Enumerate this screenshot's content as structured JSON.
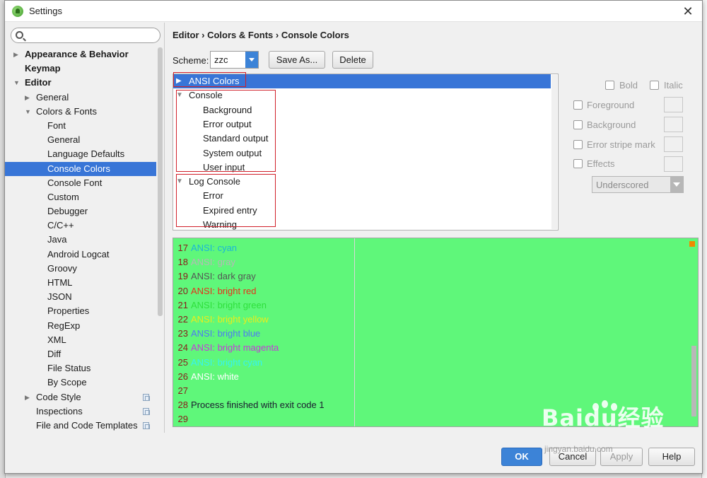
{
  "window": {
    "title": "Settings"
  },
  "sidebar": {
    "search_placeholder": "",
    "items": [
      {
        "label": "Appearance & Behavior",
        "indent": 0,
        "bold": true,
        "arrow": "▶"
      },
      {
        "label": "Keymap",
        "indent": 0,
        "bold": true,
        "arrow": ""
      },
      {
        "label": "Editor",
        "indent": 0,
        "bold": true,
        "arrow": "▼"
      },
      {
        "label": "General",
        "indent": 1,
        "bold": false,
        "arrow": "▶"
      },
      {
        "label": "Colors & Fonts",
        "indent": 1,
        "bold": false,
        "arrow": "▼"
      },
      {
        "label": "Font",
        "indent": 2,
        "bold": false,
        "arrow": ""
      },
      {
        "label": "General",
        "indent": 2,
        "bold": false,
        "arrow": ""
      },
      {
        "label": "Language Defaults",
        "indent": 2,
        "bold": false,
        "arrow": ""
      },
      {
        "label": "Console Colors",
        "indent": 2,
        "bold": false,
        "arrow": "",
        "selected": true
      },
      {
        "label": "Console Font",
        "indent": 2,
        "bold": false,
        "arrow": ""
      },
      {
        "label": "Custom",
        "indent": 2,
        "bold": false,
        "arrow": ""
      },
      {
        "label": "Debugger",
        "indent": 2,
        "bold": false,
        "arrow": ""
      },
      {
        "label": "C/C++",
        "indent": 2,
        "bold": false,
        "arrow": ""
      },
      {
        "label": "Java",
        "indent": 2,
        "bold": false,
        "arrow": ""
      },
      {
        "label": "Android Logcat",
        "indent": 2,
        "bold": false,
        "arrow": ""
      },
      {
        "label": "Groovy",
        "indent": 2,
        "bold": false,
        "arrow": ""
      },
      {
        "label": "HTML",
        "indent": 2,
        "bold": false,
        "arrow": ""
      },
      {
        "label": "JSON",
        "indent": 2,
        "bold": false,
        "arrow": ""
      },
      {
        "label": "Properties",
        "indent": 2,
        "bold": false,
        "arrow": ""
      },
      {
        "label": "RegExp",
        "indent": 2,
        "bold": false,
        "arrow": ""
      },
      {
        "label": "XML",
        "indent": 2,
        "bold": false,
        "arrow": ""
      },
      {
        "label": "Diff",
        "indent": 2,
        "bold": false,
        "arrow": ""
      },
      {
        "label": "File Status",
        "indent": 2,
        "bold": false,
        "arrow": ""
      },
      {
        "label": "By Scope",
        "indent": 2,
        "bold": false,
        "arrow": ""
      },
      {
        "label": "Code Style",
        "indent": 1,
        "bold": false,
        "arrow": "▶",
        "copy": true
      },
      {
        "label": "Inspections",
        "indent": 1,
        "bold": false,
        "arrow": "",
        "copy": true
      },
      {
        "label": "File and Code Templates",
        "indent": 1,
        "bold": false,
        "arrow": "",
        "copy": true
      }
    ]
  },
  "main": {
    "breadcrumb": "Editor › Colors & Fonts › Console Colors",
    "scheme_label": "Scheme:",
    "scheme_value": "zzc",
    "save_as_label": "Save As...",
    "delete_label": "Delete",
    "color_tree": [
      {
        "label": "ANSI Colors",
        "indent": 0,
        "arrow": "▶",
        "selected": true
      },
      {
        "label": "Console",
        "indent": 0,
        "arrow": "▼"
      },
      {
        "label": "Background",
        "indent": 1,
        "arrow": ""
      },
      {
        "label": "Error output",
        "indent": 1,
        "arrow": ""
      },
      {
        "label": "Standard output",
        "indent": 1,
        "arrow": ""
      },
      {
        "label": "System output",
        "indent": 1,
        "arrow": ""
      },
      {
        "label": "User input",
        "indent": 1,
        "arrow": ""
      },
      {
        "label": "Log Console",
        "indent": 0,
        "arrow": "▼"
      },
      {
        "label": "Error",
        "indent": 1,
        "arrow": ""
      },
      {
        "label": "Expired entry",
        "indent": 1,
        "arrow": ""
      },
      {
        "label": "Warning",
        "indent": 1,
        "arrow": ""
      }
    ]
  },
  "properties": {
    "bold_label": "Bold",
    "italic_label": "Italic",
    "foreground_label": "Foreground",
    "background_label": "Background",
    "error_stripe_label": "Error stripe mark",
    "effects_label": "Effects",
    "effect_type": "Underscored"
  },
  "preview": {
    "background": "#5ff77a",
    "lines": [
      {
        "num": "17",
        "text": "ANSI: cyan",
        "color": "#1bb5d8"
      },
      {
        "num": "18",
        "text": "ANSI: gray",
        "color": "#b7b7b7"
      },
      {
        "num": "19",
        "text": "ANSI: dark gray",
        "color": "#555555"
      },
      {
        "num": "20",
        "text": "ANSI: bright red",
        "color": "#e8301a"
      },
      {
        "num": "21",
        "text": "ANSI: bright green",
        "color": "#2fe03c"
      },
      {
        "num": "22",
        "text": "ANSI: bright yellow",
        "color": "#ecec1a"
      },
      {
        "num": "23",
        "text": "ANSI: bright blue",
        "color": "#4f7af2"
      },
      {
        "num": "24",
        "text": "ANSI: bright magenta",
        "color": "#c43bd8"
      },
      {
        "num": "25",
        "text": "ANSI: bright cyan",
        "color": "#35f3f3"
      },
      {
        "num": "26",
        "text": "ANSI: white",
        "color": "#ffffff"
      },
      {
        "num": "27",
        "text": "",
        "color": "#000000"
      },
      {
        "num": "28",
        "text": "Process finished with exit code 1",
        "color": "#1a1a2e"
      },
      {
        "num": "29",
        "text": "",
        "color": "#000000"
      }
    ]
  },
  "footer": {
    "ok_label": "OK",
    "cancel_label": "Cancel",
    "apply_label": "Apply",
    "help_label": "Help"
  },
  "watermark": {
    "text": "Baidu经验",
    "sub": "jingyan.baidu.com"
  },
  "colors": {
    "accent": "#3875d7",
    "highlight_box": "#d0202a"
  }
}
